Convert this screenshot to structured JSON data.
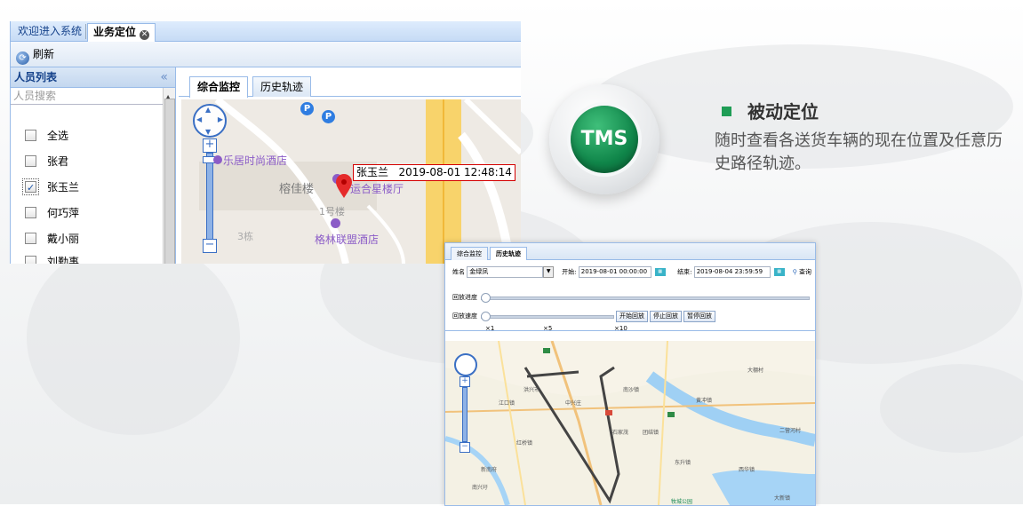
{
  "window": {
    "tabs": [
      {
        "label": "欢迎进入系统"
      },
      {
        "label": "业务定位"
      }
    ],
    "toolbar": {
      "refresh_label": "刷新"
    },
    "person_panel": {
      "title": "人员列表",
      "search_placeholder": "人员搜索",
      "items": [
        {
          "label": "全选",
          "checked": false
        },
        {
          "label": "张君",
          "checked": false
        },
        {
          "label": "张玉兰",
          "checked": true
        },
        {
          "label": "何巧萍",
          "checked": false
        },
        {
          "label": "戴小丽",
          "checked": false
        },
        {
          "label": "刘勤事",
          "checked": false
        }
      ]
    },
    "map_tabs": [
      {
        "label": "综合监控"
      },
      {
        "label": "历史轨迹"
      }
    ],
    "map": {
      "popup_name": "张玉兰",
      "popup_time": "2019-08-01 12:48:14",
      "labels": {
        "hotel1": "乐居时尚酒店",
        "building1": "榕佳楼",
        "building2": "1号楼",
        "building3": "3栋",
        "hotel2": "格林联盟酒店",
        "poi_partial": "运合星楼厅"
      }
    }
  },
  "badge": {
    "text": "TMS",
    "color": "#10864a"
  },
  "feature": {
    "title": "被动定位",
    "description": "随时查看各送货车辆的现在位置及任意历史路径轨迹。"
  },
  "history": {
    "tabs": [
      {
        "label": "综合监控"
      },
      {
        "label": "历史轨迹"
      }
    ],
    "name_label": "姓名",
    "name_value": "金绿凤",
    "start_label": "开始:",
    "start_value": "2019-08-01 00:00:00",
    "end_label": "结束:",
    "end_value": "2019-08-04 23:59:59",
    "query_label": "查询",
    "progress_label": "回放进度",
    "speed_label": "回放速度",
    "speed_ticks": [
      "×1",
      "×5",
      "×10"
    ],
    "buttons": [
      "开始回放",
      "停止回放",
      "暂停回放"
    ],
    "places": [
      "洪兴市",
      "江口镇",
      "南沙镇",
      "黄冲镇",
      "中兴庄",
      "石家茂",
      "团结镇",
      "红桥镇",
      "西华镇",
      "新南府",
      "南兴圩",
      "牧城公园",
      "大新镇",
      "东升镇",
      "大棚村",
      "二营河村"
    ]
  }
}
